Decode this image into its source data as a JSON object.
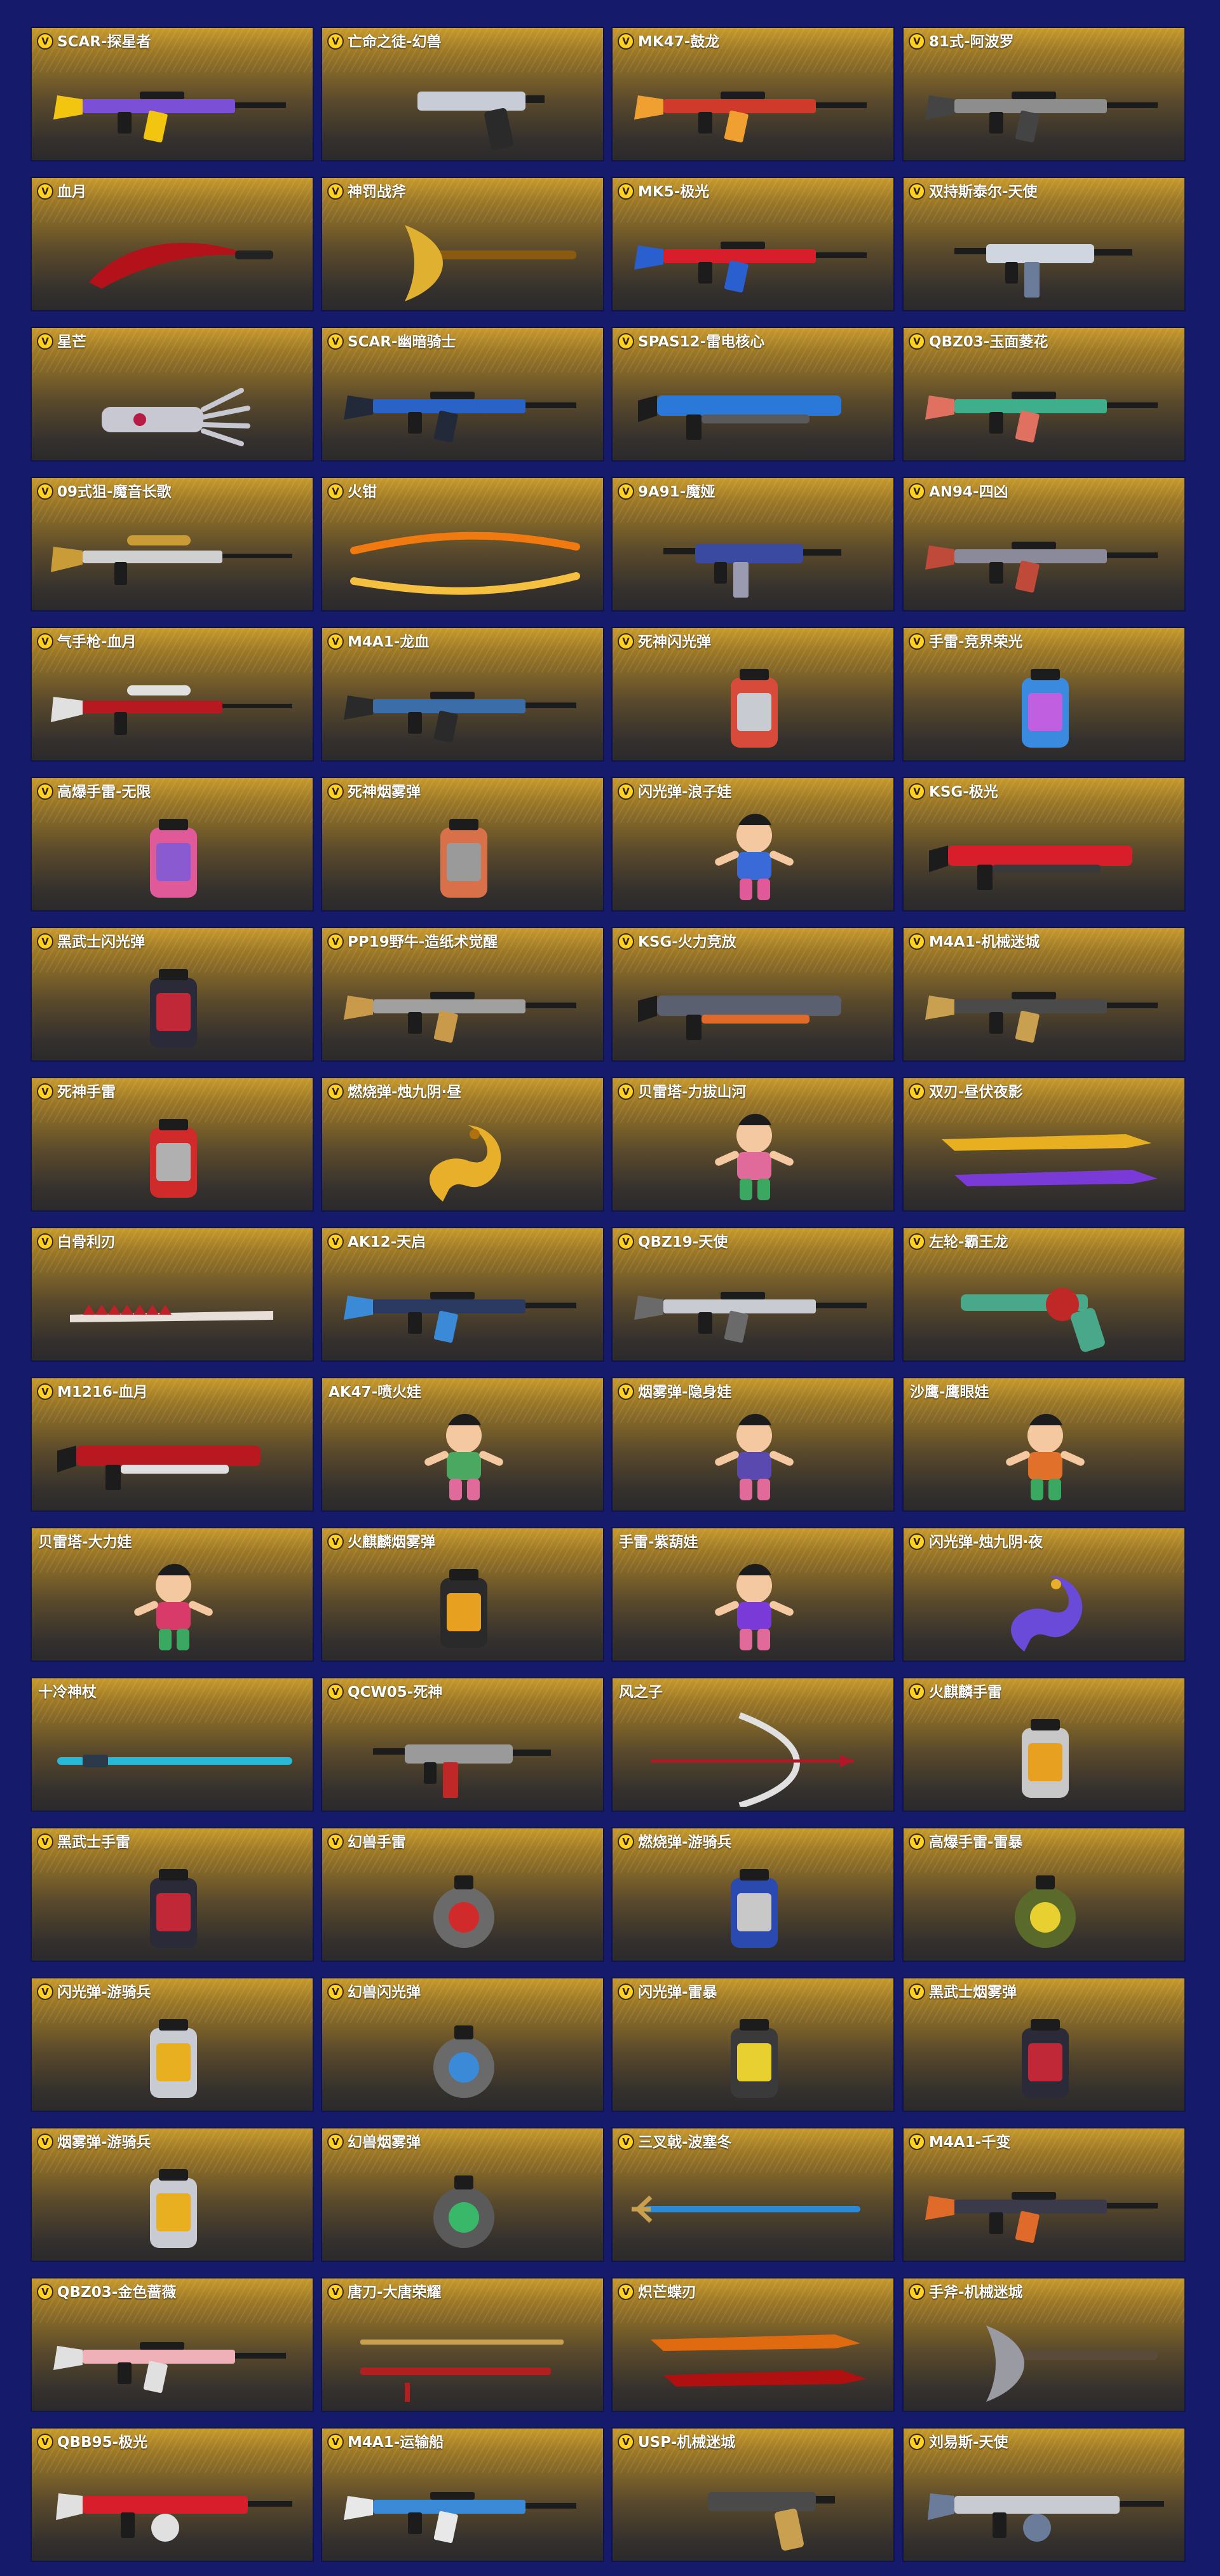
{
  "badge_label": "V",
  "colors": {
    "background": "#151a6b",
    "card_gold": "#c89a2c",
    "card_dark": "#2b2a2b",
    "badge": "#ffd21f",
    "label": "#ffffff"
  },
  "items": [
    {
      "name": "SCAR-探星者",
      "badge": true,
      "kind": "rifle",
      "colors": [
        "#7b4fd6",
        "#f2c511"
      ]
    },
    {
      "name": "亡命之徒-幻兽",
      "badge": true,
      "kind": "pistol",
      "colors": [
        "#c8ccd6",
        "#2a2a2a"
      ]
    },
    {
      "name": "MK47-鼓龙",
      "badge": true,
      "kind": "rifle",
      "colors": [
        "#d03a2a",
        "#f0a030"
      ]
    },
    {
      "name": "81式-阿波罗",
      "badge": true,
      "kind": "rifle",
      "colors": [
        "#8d8d8d",
        "#444444"
      ]
    },
    {
      "name": "血月",
      "badge": true,
      "kind": "blade",
      "colors": [
        "#b3121a",
        "#222222"
      ]
    },
    {
      "name": "神罚战斧",
      "badge": true,
      "kind": "axe",
      "colors": [
        "#e0b030",
        "#8a5a10"
      ]
    },
    {
      "name": "MK5-极光",
      "badge": true,
      "kind": "rifle",
      "colors": [
        "#d81e2a",
        "#2a5fd0"
      ]
    },
    {
      "name": "双持斯泰尔-天使",
      "badge": true,
      "kind": "smg",
      "colors": [
        "#cfd6e0",
        "#6a7c9a"
      ]
    },
    {
      "name": "星芒",
      "badge": true,
      "kind": "claw",
      "colors": [
        "#c8c8d2",
        "#b81c44"
      ]
    },
    {
      "name": "SCAR-幽暗骑士",
      "badge": true,
      "kind": "rifle",
      "colors": [
        "#2a63c8",
        "#222a3a"
      ]
    },
    {
      "name": "SPAS12-雷电核心",
      "badge": true,
      "kind": "shotgun",
      "colors": [
        "#2a78d8",
        "#5a5a5a"
      ]
    },
    {
      "name": "QBZ03-玉面菱花",
      "badge": true,
      "kind": "rifle",
      "colors": [
        "#3fae8a",
        "#e07060"
      ]
    },
    {
      "name": "09式狙-魔音长歌",
      "badge": true,
      "kind": "sniper",
      "colors": [
        "#d0d0d0",
        "#c99c38"
      ]
    },
    {
      "name": "火钳",
      "badge": true,
      "kind": "tongs",
      "colors": [
        "#f07a10",
        "#f5c040"
      ]
    },
    {
      "name": "9A91-魔娅",
      "badge": true,
      "kind": "smg",
      "colors": [
        "#3a4aa0",
        "#9a9ab0"
      ]
    },
    {
      "name": "AN94-四凶",
      "badge": true,
      "kind": "rifle",
      "colors": [
        "#8a8a9a",
        "#c04a3a"
      ]
    },
    {
      "name": "气手枪-血月",
      "badge": true,
      "kind": "sniper",
      "colors": [
        "#b81820",
        "#e0e0e0"
      ]
    },
    {
      "name": "M4A1-龙血",
      "badge": true,
      "kind": "rifle",
      "colors": [
        "#3b6ea8",
        "#2a2a2a"
      ]
    },
    {
      "name": "死神闪光弹",
      "badge": true,
      "kind": "canister",
      "colors": [
        "#d84a3a",
        "#c8ccd2"
      ]
    },
    {
      "name": "手雷-竞界荣光",
      "badge": true,
      "kind": "canister",
      "colors": [
        "#3a8ae0",
        "#c060e0"
      ]
    },
    {
      "name": "高爆手雷-无限",
      "badge": true,
      "kind": "canister",
      "colors": [
        "#e05a9a",
        "#8a5ad0"
      ]
    },
    {
      "name": "死神烟雾弹",
      "badge": true,
      "kind": "canister",
      "colors": [
        "#d8704a",
        "#9a9a9a"
      ]
    },
    {
      "name": "闪光弹-浪子娃",
      "badge": true,
      "kind": "doll",
      "colors": [
        "#3a6ad8",
        "#e05a9a"
      ]
    },
    {
      "name": "KSG-极光",
      "badge": true,
      "kind": "shotgun",
      "colors": [
        "#d81e2a",
        "#3a3a3a"
      ]
    },
    {
      "name": "黑武士闪光弹",
      "badge": true,
      "kind": "canister",
      "colors": [
        "#2a2a38",
        "#c02838"
      ]
    },
    {
      "name": "PP19野牛-造纸术觉醒",
      "badge": true,
      "kind": "rifle",
      "colors": [
        "#a0a0a0",
        "#c89a4a"
      ]
    },
    {
      "name": "KSG-火力竞放",
      "badge": true,
      "kind": "shotgun",
      "colors": [
        "#5a6070",
        "#e06a2a"
      ]
    },
    {
      "name": "M4A1-机械迷城",
      "badge": true,
      "kind": "rifle",
      "colors": [
        "#4a4a4a",
        "#c8a050"
      ]
    },
    {
      "name": "死神手雷",
      "badge": true,
      "kind": "canister",
      "colors": [
        "#d02a2a",
        "#b0b0b0"
      ]
    },
    {
      "name": "燃烧弹-烛九阴·昼",
      "badge": true,
      "kind": "dragon",
      "colors": [
        "#e8b02a",
        "#b07010"
      ]
    },
    {
      "name": "贝雷塔-力拔山河",
      "badge": true,
      "kind": "doll",
      "colors": [
        "#e06a9a",
        "#3aa860"
      ]
    },
    {
      "name": "双刃-昼伏夜影",
      "badge": true,
      "kind": "dual",
      "colors": [
        "#e8b020",
        "#7a3ad8"
      ]
    },
    {
      "name": "白骨利刃",
      "badge": true,
      "kind": "spine",
      "colors": [
        "#e8e0d8",
        "#c02028"
      ]
    },
    {
      "name": "AK12-天启",
      "badge": true,
      "kind": "rifle",
      "colors": [
        "#2a3a60",
        "#3a8ad8"
      ]
    },
    {
      "name": "QBZ19-天使",
      "badge": true,
      "kind": "rifle",
      "colors": [
        "#c8ccd2",
        "#6a6a6a"
      ]
    },
    {
      "name": "左轮-霸王龙",
      "badge": true,
      "kind": "revolver",
      "colors": [
        "#4aa88a",
        "#c02828"
      ]
    },
    {
      "name": "M1216-血月",
      "badge": true,
      "kind": "shotgun",
      "colors": [
        "#b81820",
        "#e0e0e0"
      ]
    },
    {
      "name": "AK47-喷火娃",
      "badge": false,
      "kind": "doll",
      "colors": [
        "#4aa860",
        "#e06a9a"
      ]
    },
    {
      "name": "烟雾弹-隐身娃",
      "badge": true,
      "kind": "doll",
      "colors": [
        "#5a4ab0",
        "#e06a9a"
      ]
    },
    {
      "name": "沙鹰-鹰眼娃",
      "badge": false,
      "kind": "doll",
      "colors": [
        "#e0702a",
        "#3aa860"
      ]
    },
    {
      "name": "贝雷塔-大力娃",
      "badge": false,
      "kind": "doll",
      "colors": [
        "#d83a6a",
        "#3aa860"
      ]
    },
    {
      "name": "火麒麟烟雾弹",
      "badge": true,
      "kind": "canister",
      "colors": [
        "#2a2a2a",
        "#e8a020"
      ]
    },
    {
      "name": "手雷-紫葫娃",
      "badge": false,
      "kind": "doll",
      "colors": [
        "#7a3ad8",
        "#e06a9a"
      ]
    },
    {
      "name": "闪光弹-烛九阴·夜",
      "badge": true,
      "kind": "dragon",
      "colors": [
        "#6a4ad8",
        "#e8b02a"
      ]
    },
    {
      "name": "十冷神杖",
      "badge": false,
      "kind": "staff",
      "colors": [
        "#2ab8d8",
        "#2a3a4a"
      ]
    },
    {
      "name": "QCW05-死神",
      "badge": true,
      "kind": "smg",
      "colors": [
        "#9a9a9a",
        "#c02828"
      ]
    },
    {
      "name": "风之子",
      "badge": false,
      "kind": "bow",
      "colors": [
        "#e0e0e0",
        "#b01828"
      ]
    },
    {
      "name": "火麒麟手雷",
      "badge": true,
      "kind": "canister",
      "colors": [
        "#c8c8c8",
        "#e8a020"
      ]
    },
    {
      "name": "黑武士手雷",
      "badge": true,
      "kind": "canister",
      "colors": [
        "#2a2a38",
        "#c02838"
      ]
    },
    {
      "name": "幻兽手雷",
      "badge": true,
      "kind": "grenade",
      "colors": [
        "#6a6a6a",
        "#d02a2a"
      ]
    },
    {
      "name": "燃烧弹-游骑兵",
      "badge": true,
      "kind": "canister",
      "colors": [
        "#2a4ab0",
        "#c8c8c8"
      ]
    },
    {
      "name": "高爆手雷-雷暴",
      "badge": true,
      "kind": "grenade",
      "colors": [
        "#5a6a2a",
        "#e8d030"
      ]
    },
    {
      "name": "闪光弹-游骑兵",
      "badge": true,
      "kind": "canister",
      "colors": [
        "#c8ccd2",
        "#e8b020"
      ]
    },
    {
      "name": "幻兽闪光弹",
      "badge": true,
      "kind": "grenade",
      "colors": [
        "#6a6a6a",
        "#3a8ad8"
      ]
    },
    {
      "name": "闪光弹-雷暴",
      "badge": true,
      "kind": "canister",
      "colors": [
        "#3a3a3a",
        "#e8d030"
      ]
    },
    {
      "name": "黑武士烟雾弹",
      "badge": true,
      "kind": "canister",
      "colors": [
        "#2a2a38",
        "#c02838"
      ]
    },
    {
      "name": "烟雾弹-游骑兵",
      "badge": true,
      "kind": "canister",
      "colors": [
        "#c8ccd2",
        "#e8b020"
      ]
    },
    {
      "name": "幻兽烟雾弹",
      "badge": true,
      "kind": "grenade",
      "colors": [
        "#5a5a5a",
        "#3ab86a"
      ]
    },
    {
      "name": "三叉戟-波塞冬",
      "badge": true,
      "kind": "trident",
      "colors": [
        "#2a8ad8",
        "#c8a050"
      ]
    },
    {
      "name": "M4A1-千变",
      "badge": true,
      "kind": "rifle",
      "colors": [
        "#3a3a4a",
        "#e06a2a"
      ]
    },
    {
      "name": "QBZ03-金色蔷薇",
      "badge": true,
      "kind": "rifle",
      "colors": [
        "#f0b0b8",
        "#e0e0e0"
      ]
    },
    {
      "name": "唐刀-大唐荣耀",
      "badge": true,
      "kind": "katana",
      "colors": [
        "#c8a050",
        "#b02020"
      ]
    },
    {
      "name": "炽芒蝶刃",
      "badge": true,
      "kind": "dual",
      "colors": [
        "#e06a10",
        "#b01010"
      ]
    },
    {
      "name": "手斧-机械迷城",
      "badge": true,
      "kind": "axe",
      "colors": [
        "#9a9aa2",
        "#5a4a3a"
      ]
    },
    {
      "name": "QBB95-极光",
      "badge": true,
      "kind": "lmg",
      "colors": [
        "#d81e2a",
        "#e0e0e0"
      ]
    },
    {
      "name": "M4A1-运输船",
      "badge": true,
      "kind": "rifle",
      "colors": [
        "#3a8ad8",
        "#e8e8e8"
      ]
    },
    {
      "name": "USP-机械迷城",
      "badge": true,
      "kind": "pistol",
      "colors": [
        "#4a4a4a",
        "#c8a050"
      ]
    },
    {
      "name": "刘易斯-天使",
      "badge": true,
      "kind": "lmg",
      "colors": [
        "#c8ccd2",
        "#6a7c9a"
      ]
    }
  ]
}
